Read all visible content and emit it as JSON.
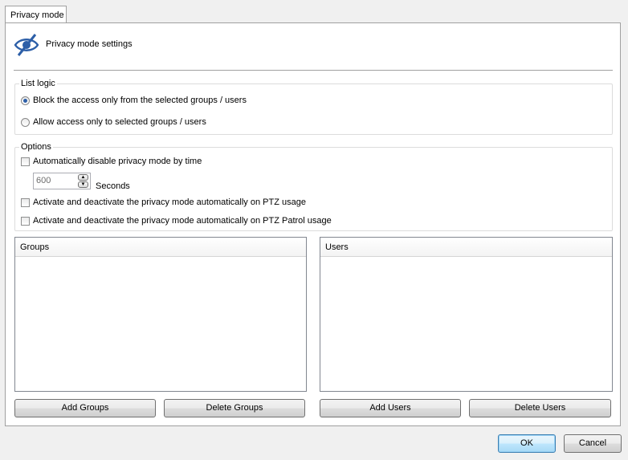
{
  "tab": {
    "label": "Privacy mode"
  },
  "header": {
    "title": "Privacy mode settings",
    "icon": "eye-slash-icon"
  },
  "list_logic": {
    "label": "List logic",
    "options": [
      {
        "label": "Block the access only from the selected groups / users",
        "checked": true
      },
      {
        "label": "Allow access only to selected groups / users",
        "checked": false
      }
    ]
  },
  "options": {
    "label": "Options",
    "auto_disable": {
      "label": "Automatically disable privacy mode by time",
      "checked": false
    },
    "timeout": {
      "value": "600",
      "unit": "Seconds"
    },
    "ptz_usage": {
      "label": "Activate and deactivate the privacy mode automatically on PTZ usage",
      "checked": false
    },
    "ptz_patrol": {
      "label": "Activate and deactivate the privacy mode automatically on PTZ Patrol usage",
      "checked": false
    }
  },
  "groups": {
    "header": "Groups",
    "add_label": "Add Groups",
    "delete_label": "Delete Groups"
  },
  "users": {
    "header": "Users",
    "add_label": "Add Users",
    "delete_label": "Delete Users"
  },
  "dialog": {
    "ok_label": "OK",
    "cancel_label": "Cancel"
  },
  "colors": {
    "accent": "#2d5fa8",
    "default_button_border": "#3c7fb1"
  }
}
